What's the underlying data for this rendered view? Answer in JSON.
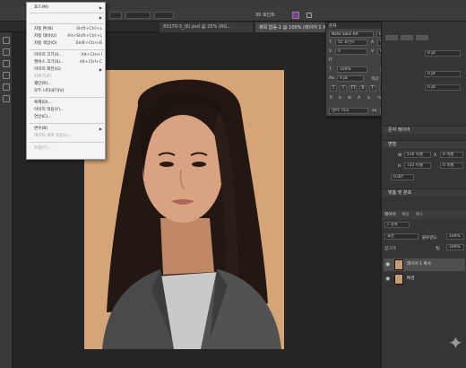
{
  "menu": {
    "items": [
      {
        "label": "포드(M)",
        "shortcut": "",
        "submenu": true,
        "disabled": false
      },
      {
        "label": "",
        "shortcut": "",
        "submenu": true,
        "disabled": false
      },
      {
        "label": "자동 톤(N)",
        "shortcut": "Shift+Ctrl+L",
        "submenu": false,
        "disabled": false
      },
      {
        "label": "자동 대비(U)",
        "shortcut": "Alt+Shift+Ctrl+L",
        "submenu": false,
        "disabled": false
      },
      {
        "label": "자동 색상(O)",
        "shortcut": "Shift+Ctrl+B",
        "submenu": false,
        "disabled": false
      },
      {
        "label": "이미지 크기(I)...",
        "shortcut": "Alt+Ctrl+I",
        "submenu": false,
        "disabled": false
      },
      {
        "label": "캔버스 크기(S)...",
        "shortcut": "Alt+Ctrl+C",
        "submenu": false,
        "disabled": false
      },
      {
        "label": "이미지 회전(G)",
        "shortcut": "",
        "submenu": true,
        "disabled": false
      },
      {
        "label": "자르기(P)",
        "shortcut": "",
        "submenu": false,
        "disabled": true
      },
      {
        "label": "재단(R)...",
        "shortcut": "",
        "submenu": false,
        "disabled": false
      },
      {
        "label": "모두 나타내기(V)",
        "shortcut": "",
        "submenu": false,
        "disabled": false
      },
      {
        "label": "복제(D)...",
        "shortcut": "",
        "submenu": false,
        "disabled": false
      },
      {
        "label": "이미지 적용(Y)...",
        "shortcut": "",
        "submenu": false,
        "disabled": false
      },
      {
        "label": "연산(C)...",
        "shortcut": "",
        "submenu": false,
        "disabled": false
      },
      {
        "label": "변수(B)",
        "shortcut": "",
        "submenu": true,
        "disabled": false
      },
      {
        "label": "데이터 세트 적용(L)...",
        "shortcut": "",
        "submenu": false,
        "disabled": true
      },
      {
        "label": "트랩(T)...",
        "shortcut": "",
        "submenu": false,
        "disabled": true
      }
    ]
  },
  "tabs": [
    {
      "label": "83170-3_(6).psd @ 25% (RG...",
      "active": false
    },
    {
      "label": "제목 없음-1 @ 100% (레이어 1 복사, RGB/8) *",
      "active": true
    }
  ],
  "options": {
    "size_value": "30 포인트"
  },
  "char_panel": {
    "title": "문자",
    "font_family": "Noto Sans KR",
    "font_style": "Bold",
    "font_size": "55 포인트",
    "leading": "55 포인트",
    "kerning": "0",
    "tracking": "0",
    "scale_v": "100%",
    "scale_h": "100%",
    "baseline": "0 pt",
    "color_label": "색상:",
    "color": "#7f3b9a",
    "lang": "영어: 미국",
    "aa": "선명하게",
    "styles": [
      "T",
      "T",
      "TT",
      "Tr",
      "T'",
      "T,",
      "T",
      "T"
    ]
  },
  "right": {
    "props_title": "문자 레이어",
    "transform_label": "변형",
    "w_label": "W",
    "w_val": "516 픽셀",
    "h_label": "H",
    "h_val": "725 픽셀",
    "x_label": "X",
    "x_val": "0 픽셀",
    "y_val": "0 픽셀",
    "angle": "0.00°",
    "align_title": "맞춤 및 분포",
    "layers_tabs": [
      "레이어",
      "채널",
      "패스"
    ],
    "kind": "종류",
    "blend": "표준",
    "opacity_label": "불투명도:",
    "opacity": "100%",
    "lock_label": "잠그기:",
    "fill_label": "칠:",
    "fill": "100%",
    "layers": [
      {
        "name": "레이어 1 복사",
        "selected": true
      },
      {
        "name": "배경",
        "selected": false
      }
    ]
  }
}
